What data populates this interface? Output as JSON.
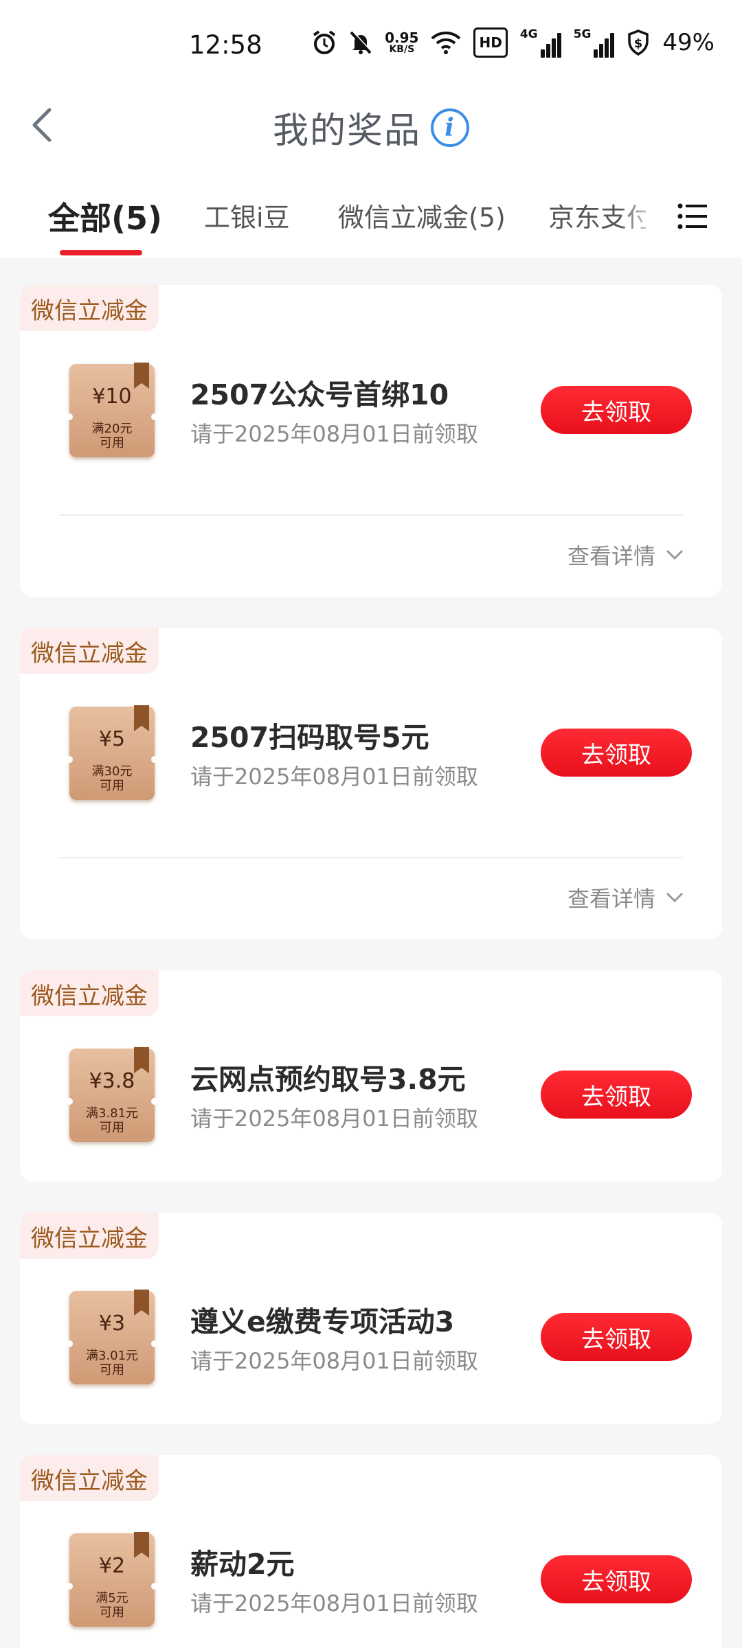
{
  "status_bar": {
    "time": "12:58",
    "net_speed_value": "0.95",
    "net_speed_unit": "KB/S",
    "hd_label": "HD",
    "net1_label": "4G",
    "net2_label": "5G",
    "battery": "49%"
  },
  "header": {
    "title": "我的奖品",
    "info_glyph": "i"
  },
  "tabs": [
    {
      "label": "全部(5)",
      "active": true
    },
    {
      "label": "工银i豆",
      "active": false
    },
    {
      "label": "微信立减金(5)",
      "active": false
    },
    {
      "label": "京东支付",
      "active": false
    }
  ],
  "claim_label": "去领取",
  "details_label": "查看详情",
  "cards": [
    {
      "tag": "微信立减金",
      "amount": "¥10",
      "condition_line1": "满20元",
      "condition_line2": "可用",
      "name": "2507公众号首绑10",
      "deadline": "请于2025年08月01日前领取"
    },
    {
      "tag": "微信立减金",
      "amount": "¥5",
      "condition_line1": "满30元",
      "condition_line2": "可用",
      "name": "2507扫码取号5元",
      "deadline": "请于2025年08月01日前领取"
    },
    {
      "tag": "微信立减金",
      "amount": "¥3.8",
      "condition_line1": "满3.81元",
      "condition_line2": "可用",
      "name": "云网点预约取号3.8元",
      "deadline": "请于2025年08月01日前领取"
    },
    {
      "tag": "微信立减金",
      "amount": "¥3",
      "condition_line1": "满3.01元",
      "condition_line2": "可用",
      "name": "遵义e缴费专项活动3",
      "deadline": "请于2025年08月01日前领取"
    },
    {
      "tag": "微信立减金",
      "amount": "¥2",
      "condition_line1": "满5元",
      "condition_line2": "可用",
      "name": "薪动2元",
      "deadline": "请于2025年08月01日前领取"
    }
  ],
  "colors": {
    "accent_red": "#e8202a",
    "tag_bg": "#fdecec",
    "tag_text": "#9b5a1e",
    "info_blue": "#3a8ee6"
  }
}
